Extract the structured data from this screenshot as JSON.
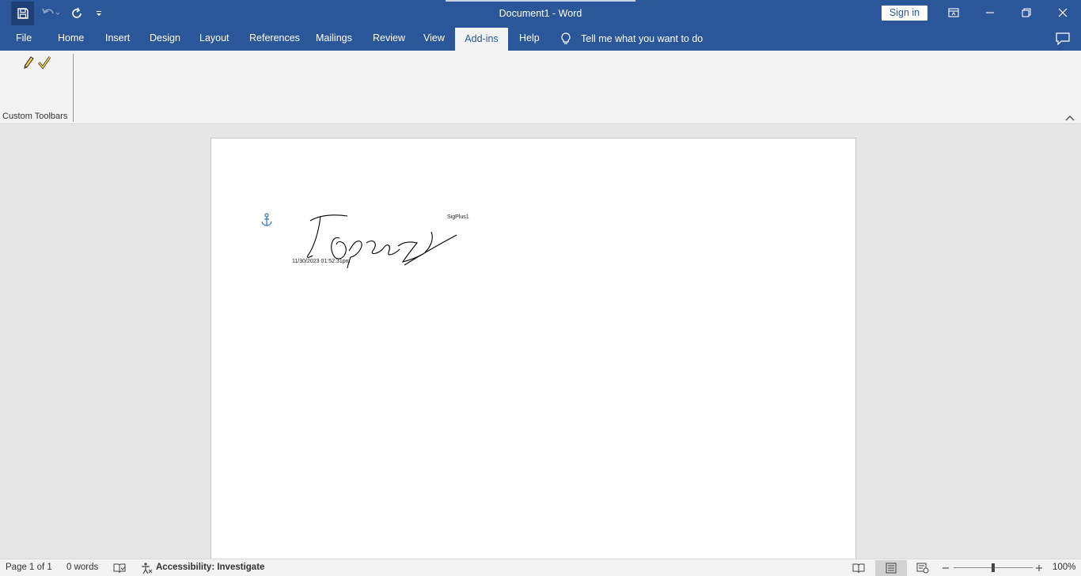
{
  "titlebar": {
    "doc_title": "Document1  -  Word",
    "signin_label": "Sign in"
  },
  "tabs": [
    {
      "label": "File"
    },
    {
      "label": "Home"
    },
    {
      "label": "Insert"
    },
    {
      "label": "Design"
    },
    {
      "label": "Layout"
    },
    {
      "label": "References"
    },
    {
      "label": "Mailings"
    },
    {
      "label": "Review"
    },
    {
      "label": "View"
    },
    {
      "label": "Add-ins",
      "active": true
    },
    {
      "label": "Help"
    }
  ],
  "tellme": {
    "label": "Tell me what you want to do"
  },
  "ribbon": {
    "group_label": "Custom Toolbars",
    "icons": [
      "pencil-icon",
      "checkmark-icon"
    ]
  },
  "document": {
    "signature_label": "SigPlus1",
    "signature_timestamp": "11/30/2023  01:52:31pm"
  },
  "statusbar": {
    "page": "Page 1 of 1",
    "words": "0 words",
    "accessibility": "Accessibility: Investigate",
    "zoom": "100%"
  },
  "colors": {
    "brand": "#2b579a",
    "ribbon": "#f3f3f3",
    "canvas": "#e6e6e6"
  }
}
